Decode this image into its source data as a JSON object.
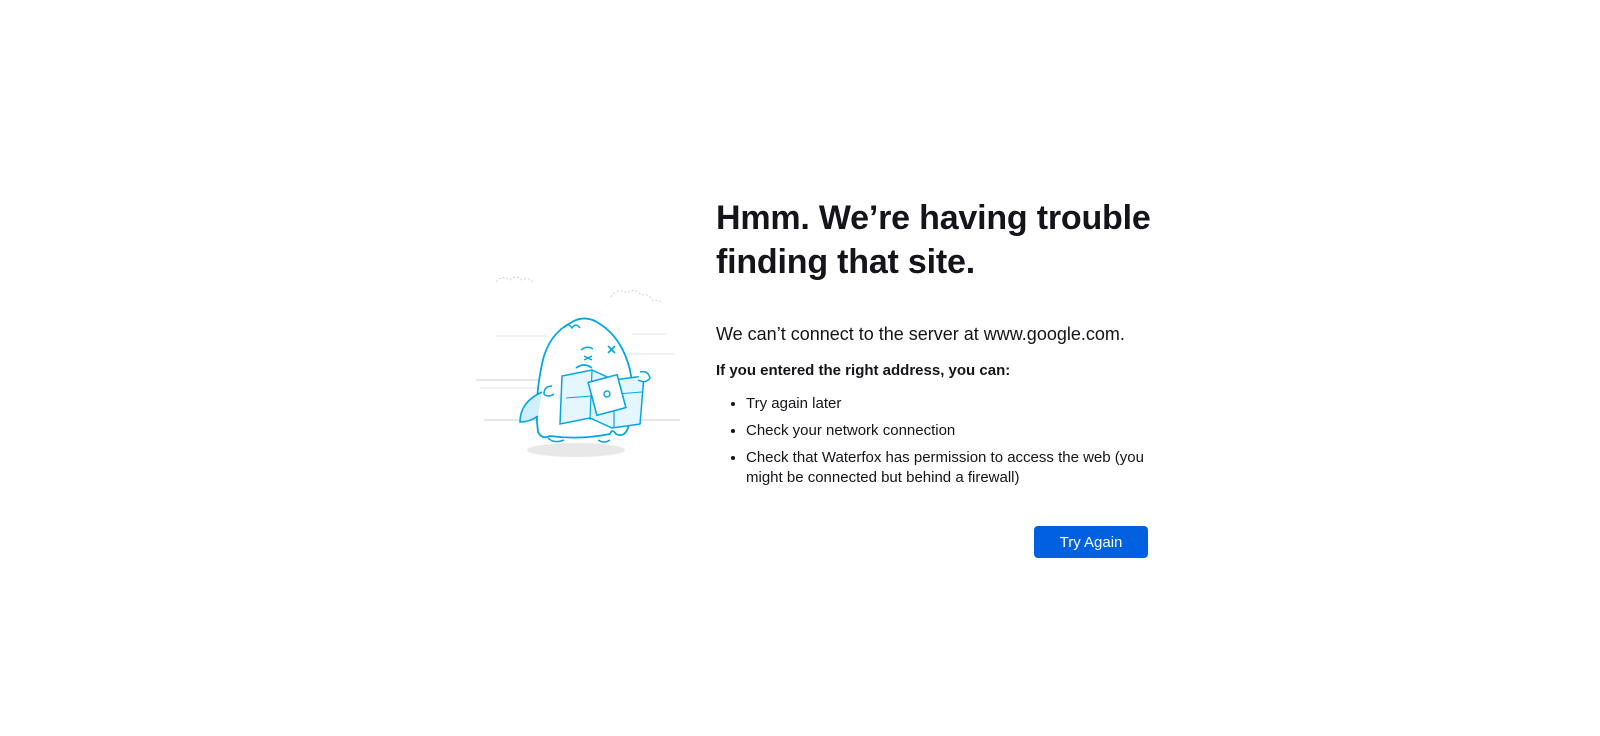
{
  "error": {
    "title": "Hmm. We’re having trouble finding that site.",
    "description": "We can’t connect to the server at www.google.com.",
    "hint": "If you entered the right address, you can:",
    "tips": [
      "Try again later",
      "Check your network connection",
      "Check that Waterfox has permission to access the web (you might be connected but behind a firewall)"
    ],
    "try_again_label": "Try Again"
  },
  "colors": {
    "accent": "#0061e0",
    "illustration": "#00a7e0",
    "text": "#15141a"
  },
  "icons": {
    "illustration": "confused-monster-with-map-illustration"
  }
}
